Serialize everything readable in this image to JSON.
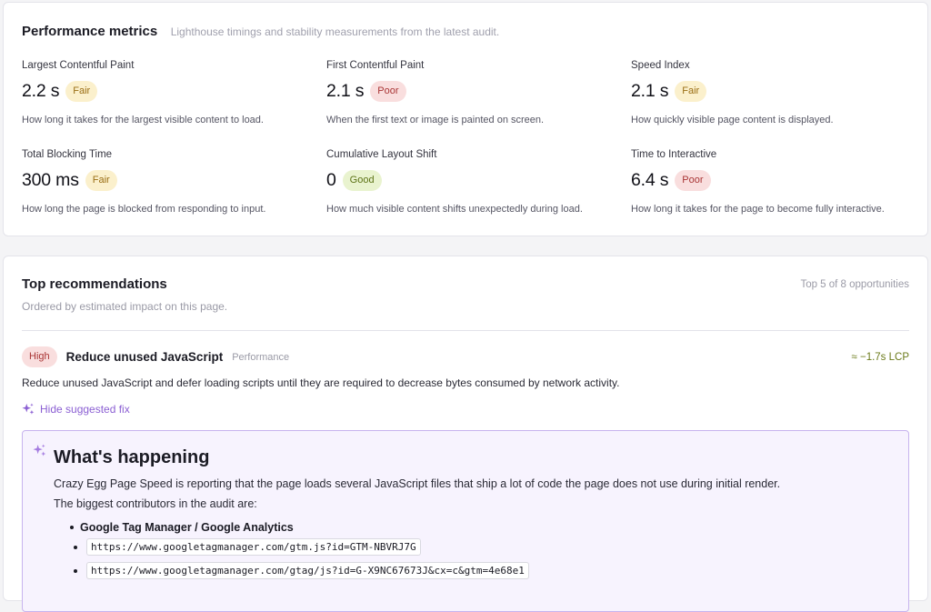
{
  "metrics_card": {
    "title": "Performance metrics",
    "subtitle": "Lighthouse timings and stability measurements from the latest audit.",
    "items": [
      {
        "label": "Largest Contentful Paint",
        "value": "2.2 s",
        "rating": "Fair",
        "description": "How long it takes for the largest visible content to load."
      },
      {
        "label": "First Contentful Paint",
        "value": "2.1 s",
        "rating": "Poor",
        "description": "When the first text or image is painted on screen."
      },
      {
        "label": "Speed Index",
        "value": "2.1 s",
        "rating": "Fair",
        "description": "How quickly visible page content is displayed."
      },
      {
        "label": "Total Blocking Time",
        "value": "300 ms",
        "rating": "Fair",
        "description": "How long the page is blocked from responding to input."
      },
      {
        "label": "Cumulative Layout Shift",
        "value": "0",
        "rating": "Good",
        "description": "How much visible content shifts unexpectedly during load."
      },
      {
        "label": "Time to Interactive",
        "value": "6.4 s",
        "rating": "Poor",
        "description": "How long it takes for the page to become fully interactive."
      }
    ]
  },
  "recommendations": {
    "title": "Top recommendations",
    "subtitle": "Ordered by estimated impact on this page.",
    "count": "Top 5 of 8 opportunities",
    "item": {
      "priority": "High",
      "title": "Reduce unused JavaScript",
      "category": "Performance",
      "impact": "≈ −1.7s LCP",
      "description": "Reduce unused JavaScript and defer loading scripts until they are required to decrease bytes consumed by network activity.",
      "fix_toggle": "Hide suggested fix",
      "fix": {
        "heading": "What's happening",
        "paragraph1": "Crazy Egg Page Speed is reporting that the page loads several JavaScript files that ship a lot of code the page does not use during initial render.",
        "paragraph2": "The biggest contributors in the audit are:",
        "contributor": "Google Tag Manager / Google Analytics",
        "urls": [
          "https://www.googletagmanager.com/gtm.js?id=GTM-NBVRJ7G",
          "https://www.googletagmanager.com/gtag/js?id=G-X9NC67673J&cx=c&gtm=4e68e1"
        ]
      }
    }
  },
  "colors": {
    "fair_bg": "#fbf0cc",
    "fair_fg": "#9a6e14",
    "poor_bg": "#f9dede",
    "poor_fg": "#a93535",
    "good_bg": "#e9f3cf",
    "good_fg": "#5d7317",
    "accent": "#8b5fd3"
  },
  "icons": {
    "fix_toggle": "sparkles-icon",
    "panel": "sparkles-icon"
  }
}
